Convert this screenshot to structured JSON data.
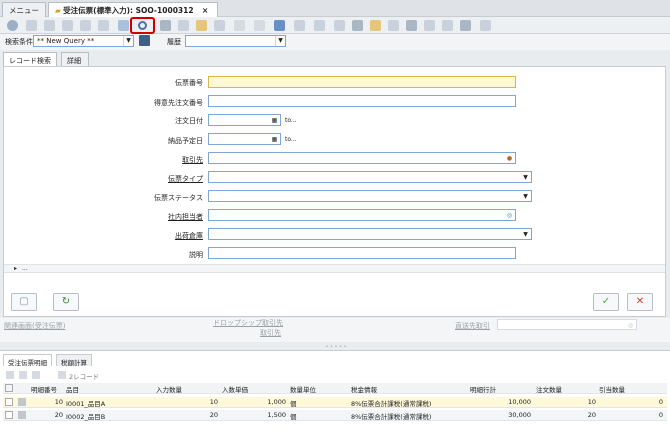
{
  "tabs": {
    "menu": "メニュー",
    "active": "受注伝票(標準入力): SOO-1000312",
    "close": "×"
  },
  "query": {
    "label": "検索条件",
    "value": "** New Query **",
    "history_label": "履歴",
    "history_value": ""
  },
  "subtabs": [
    "レコード検索",
    "詳細"
  ],
  "form": {
    "fields": [
      {
        "label": "伝票番号",
        "underline": false
      },
      {
        "label": "得意先注文番号",
        "underline": false
      },
      {
        "label": "注文日付",
        "underline": false
      },
      {
        "label": "納品予定日",
        "underline": false
      },
      {
        "label": "取引先",
        "underline": true
      },
      {
        "label": "伝票タイプ",
        "underline": true
      },
      {
        "label": "伝票ステータス",
        "underline": false
      },
      {
        "label": "社内担当者",
        "underline": true
      },
      {
        "label": "出荷倉庫",
        "underline": true
      },
      {
        "label": "説明",
        "underline": false
      }
    ],
    "to": "to...",
    "more": "..."
  },
  "under": {
    "left": "関連画面(受注伝票)",
    "mid_top": "ドロップシップ取引先",
    "mid": "取引先",
    "right_label": "直送先取引",
    "right_value": ""
  },
  "bottom": {
    "tabs": [
      "受注伝票明細",
      "税額計算"
    ],
    "record_count": "2レコード",
    "columns": [
      "明細番号",
      "品目",
      "入力数量",
      "入数単価",
      "数量単位",
      "税金情報",
      "明細行計",
      "注文数量",
      "引当数量"
    ],
    "rows": [
      {
        "line": "10",
        "item": "I0001_品目A",
        "qty": "10",
        "price": "1,000",
        "uom": "個",
        "tax": "8%伝票合計課税(通常課税)",
        "total": "10,000",
        "order": "10",
        "reserved": "0"
      },
      {
        "line": "20",
        "item": "I0002_品目B",
        "qty": "20",
        "price": "1,500",
        "uom": "個",
        "tax": "8%伝票合計課税(通常課税)",
        "total": "30,000",
        "order": "20",
        "reserved": "0"
      }
    ]
  },
  "colors": {
    "accent": "#7fa7d6",
    "highlight": "#d00000",
    "ok": "#5aa82e",
    "cancel": "#d93a2b",
    "row_selected": "#fff9d9"
  }
}
